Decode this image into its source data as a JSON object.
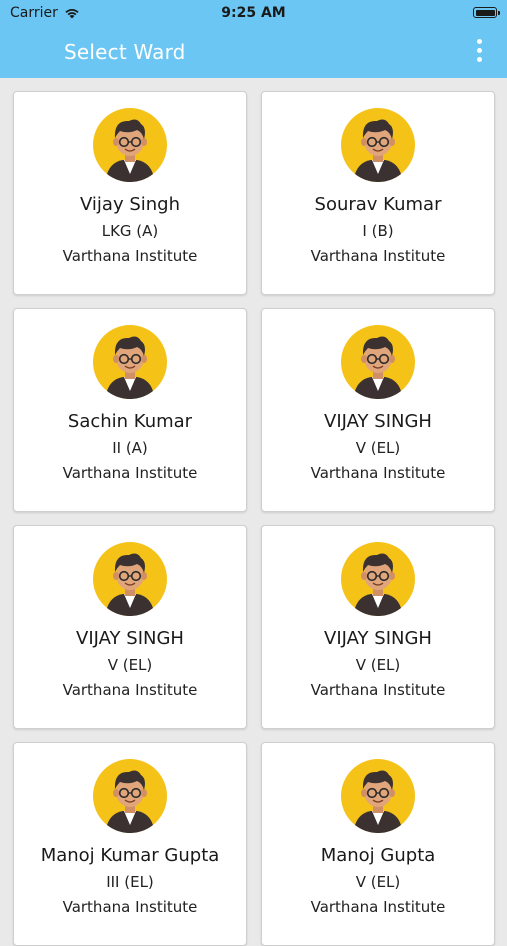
{
  "status_bar": {
    "carrier": "Carrier",
    "time": "9:25 AM"
  },
  "app_bar": {
    "title": "Select Ward"
  },
  "icons": {
    "wifi": "wifi-icon",
    "battery": "battery-icon",
    "menu": "more-vert-icon",
    "avatar": "student-avatar-icon"
  },
  "colors": {
    "primary": "#6cc6f4",
    "avatar_bg": "#f5c218"
  },
  "wards": [
    {
      "name": "Vijay Singh",
      "class": "LKG (A)",
      "school": "Varthana Institute"
    },
    {
      "name": "Sourav Kumar",
      "class": "I (B)",
      "school": "Varthana Institute"
    },
    {
      "name": "Sachin Kumar",
      "class": "II (A)",
      "school": "Varthana Institute"
    },
    {
      "name": "VIJAY SINGH",
      "class": "V (EL)",
      "school": "Varthana Institute"
    },
    {
      "name": "VIJAY SINGH",
      "class": "V (EL)",
      "school": "Varthana Institute"
    },
    {
      "name": "VIJAY SINGH",
      "class": "V (EL)",
      "school": "Varthana Institute"
    },
    {
      "name": "Manoj Kumar Gupta",
      "class": "III (EL)",
      "school": "Varthana Institute"
    },
    {
      "name": "Manoj Gupta",
      "class": "V (EL)",
      "school": "Varthana Institute"
    }
  ]
}
